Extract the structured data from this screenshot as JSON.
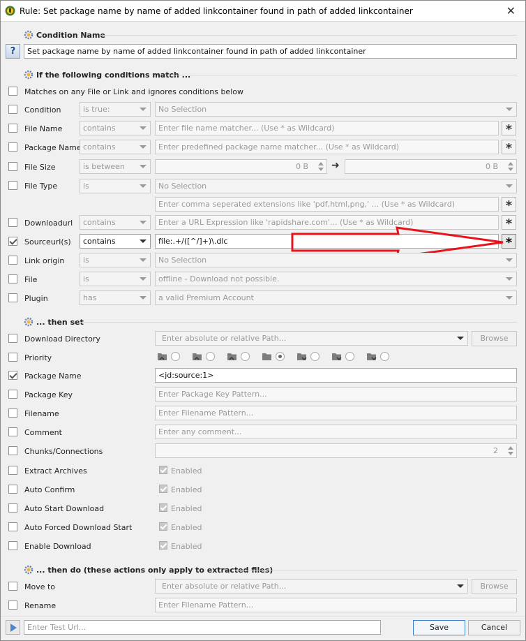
{
  "window": {
    "title": "Rule: Set package name by name of added linkcontainer found in path of added linkcontainer"
  },
  "sections": {
    "condition_name": "Condition Name",
    "conditions": "If the following conditions match ...",
    "then_set": "... then set",
    "then_do": "... then do (these actions only apply to extracted files)"
  },
  "name_value": "Set package name by name of added linkcontainer found in path of added linkcontainer",
  "help_label": "?",
  "matches_any": "Matches on any File or Link and ignores conditions below",
  "conditions": {
    "condition": {
      "label": "Condition",
      "op": "is true:",
      "value": "No Selection"
    },
    "file_name": {
      "label": "File Name",
      "op": "contains",
      "placeholder": "Enter file name matcher... (Use * as Wildcard)"
    },
    "package_name": {
      "label": "Package Name",
      "op": "contains",
      "placeholder": "Enter predefined package name matcher... (Use * as Wildcard)"
    },
    "file_size": {
      "label": "File Size",
      "op": "is between",
      "from": "0 B",
      "to": "0 B"
    },
    "file_type": {
      "label": "File Type",
      "op": "is",
      "value": "No Selection",
      "ext_placeholder": "Enter comma seperated extensions like 'pdf,html,png,' ... (Use * as Wildcard)"
    },
    "download_url": {
      "label": "Downloadurl",
      "op": "contains",
      "placeholder": "Enter a URL Expression like 'rapidshare.com'... (Use * as Wildcard)"
    },
    "source_url": {
      "label": "Sourceurl(s)",
      "op": "contains",
      "value": "file:.+/([^/]+)\\.dlc"
    },
    "link_origin": {
      "label": "Link origin",
      "op": "is",
      "value": "No Selection"
    },
    "file": {
      "label": "File",
      "op": "is",
      "value": "offline - Download not possible."
    },
    "plugin": {
      "label": "Plugin",
      "op": "has",
      "value": "a valid Premium Account"
    }
  },
  "wildcard_label": "*",
  "set": {
    "download_directory": {
      "label": "Download Directory",
      "placeholder": "Enter absolute or relative Path...",
      "browse": "Browse"
    },
    "priority": {
      "label": "Priority",
      "selected_index": 3
    },
    "package_name": {
      "label": "Package Name",
      "value": "<jd:source:1>"
    },
    "package_key": {
      "label": "Package Key",
      "placeholder": "Enter Package Key Pattern..."
    },
    "filename": {
      "label": "Filename",
      "placeholder": "Enter Filename Pattern..."
    },
    "comment": {
      "label": "Comment",
      "placeholder": "Enter any comment..."
    },
    "chunks": {
      "label": "Chunks/Connections",
      "value": "2"
    },
    "extract_archives": {
      "label": "Extract Archives",
      "value": "Enabled"
    },
    "auto_confirm": {
      "label": "Auto Confirm",
      "value": "Enabled"
    },
    "auto_start": {
      "label": "Auto Start Download",
      "value": "Enabled"
    },
    "auto_forced": {
      "label": "Auto Forced Download Start",
      "value": "Enabled"
    },
    "enable_download": {
      "label": "Enable Download",
      "value": "Enabled"
    }
  },
  "do": {
    "move_to": {
      "label": "Move to",
      "placeholder": "Enter absolute or relative Path...",
      "browse": "Browse"
    },
    "rename": {
      "label": "Rename",
      "placeholder": "Enter Filename Pattern..."
    }
  },
  "footer": {
    "test_placeholder": "Enter Test Url...",
    "save": "Save",
    "cancel": "Cancel"
  },
  "colors": {
    "annotation_arrow": "#e8141c",
    "accent": "#3c7fcf"
  }
}
